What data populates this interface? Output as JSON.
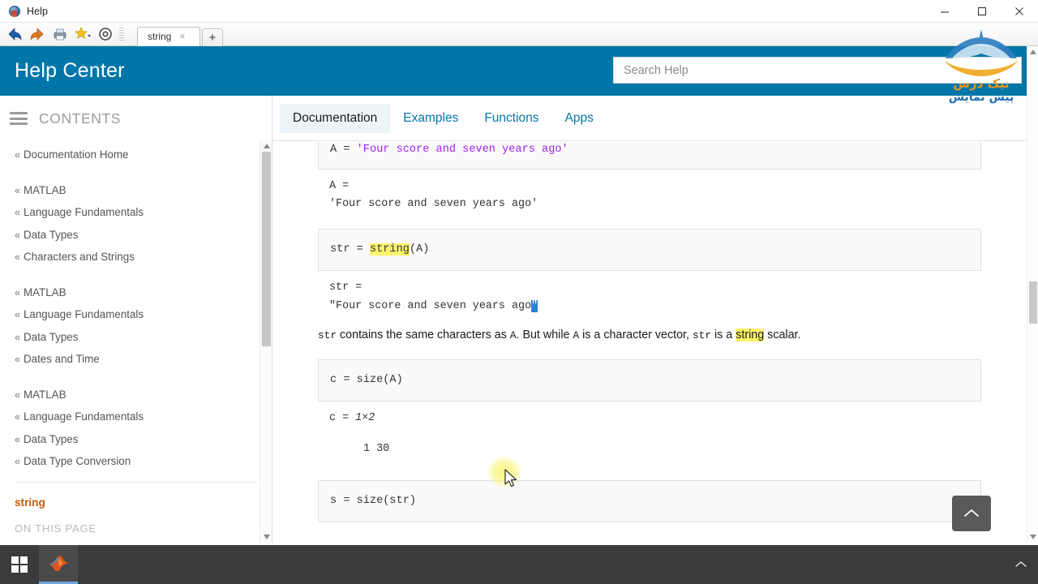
{
  "window": {
    "title": "Help",
    "app_icon": "help-globe-icon",
    "minimize_label": "Minimize",
    "maximize_label": "Maximize",
    "close_label": "Close"
  },
  "toolbar": {
    "icons": [
      {
        "name": "back-arrow-icon",
        "label": "Back"
      },
      {
        "name": "forward-arrow-icon",
        "label": "Forward"
      },
      {
        "name": "print-icon",
        "label": "Print"
      },
      {
        "name": "favorites-star-icon",
        "label": "Favorites"
      },
      {
        "name": "target-circle-icon",
        "label": "Locate"
      }
    ],
    "tabs": [
      {
        "label": "string",
        "close": "×",
        "active": true
      }
    ],
    "new_tab_label": "+"
  },
  "header": {
    "logo_text": "Help Center",
    "accent_color": "#0076a8",
    "search_placeholder": "Search Help"
  },
  "watermark": {
    "line1": "نیک درس",
    "line2": "پیش نمایش",
    "line1_color": "#e8951f",
    "line2_color": "#1f6fb5"
  },
  "sidebar": {
    "contents_label": "CONTENTS",
    "hamburger_icon": "hamburger-menu-icon",
    "groups": [
      {
        "items": [
          {
            "label": "Documentation Home"
          }
        ]
      },
      {
        "items": [
          {
            "label": "MATLAB"
          },
          {
            "label": "Language Fundamentals"
          },
          {
            "label": "Data Types"
          },
          {
            "label": "Characters and Strings"
          }
        ]
      },
      {
        "items": [
          {
            "label": "MATLAB"
          },
          {
            "label": "Language Fundamentals"
          },
          {
            "label": "Data Types"
          },
          {
            "label": "Dates and Time"
          }
        ]
      },
      {
        "items": [
          {
            "label": "MATLAB"
          },
          {
            "label": "Language Fundamentals"
          },
          {
            "label": "Data Types"
          },
          {
            "label": "Data Type Conversion"
          }
        ]
      }
    ],
    "chevron": "«",
    "current_page": "string",
    "on_this_page_label": "ON THIS PAGE"
  },
  "content": {
    "tabs": [
      {
        "label": "Documentation",
        "active": true
      },
      {
        "label": "Examples",
        "active": false
      },
      {
        "label": "Functions",
        "active": false
      },
      {
        "label": "Apps",
        "active": false
      }
    ],
    "blocks": [
      {
        "type": "code",
        "pre": "A = ",
        "string_literal": "'Four score and seven years ago'",
        "post": ""
      },
      {
        "type": "output",
        "line1": "A =",
        "line2": "'Four score and seven years ago'"
      },
      {
        "type": "code2",
        "pre": "str = ",
        "highlight": "string",
        "post": "(A)"
      },
      {
        "type": "output2",
        "line1": "str =",
        "line2_pre": "\"Four score and seven years ago",
        "line2_sel": "\""
      },
      {
        "type": "paragraph",
        "t1": "str",
        "t2": " contains the same characters as ",
        "t3": "A",
        "t4": ". But while ",
        "t5": "A",
        "t6": " is a character vector, ",
        "t7": "str",
        "t8": " is a ",
        "t9": "string",
        "t10": " scalar."
      },
      {
        "type": "code3",
        "text": "c = size(A)"
      },
      {
        "type": "output3",
        "line1_pre": "c = ",
        "line1_dim": "1×2",
        "line2": "1    30"
      },
      {
        "type": "code4",
        "text": "s = size(str)"
      }
    ],
    "back_to_top_icon": "chevron-up-icon",
    "back_to_top_label": "Back to top"
  },
  "taskbar": {
    "start_icon": "windows-start-icon",
    "apps": [
      {
        "name": "matlab-taskbar-icon",
        "label": "MATLAB"
      }
    ],
    "tray_icon": "chevron-up-tray-icon"
  }
}
